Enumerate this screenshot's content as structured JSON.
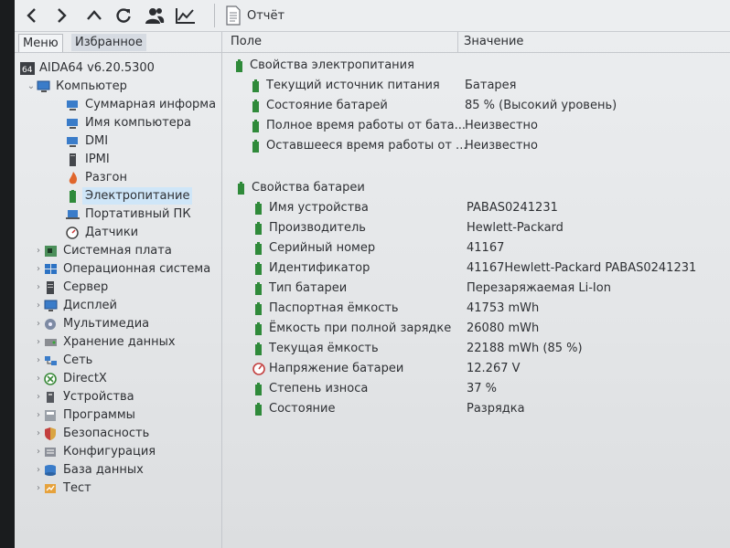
{
  "toolbar": {
    "report_label": "Отчёт"
  },
  "tabs": {
    "menu": "Меню",
    "favorites": "Избранное"
  },
  "tree": {
    "root": "AIDA64 v6.20.5300",
    "computer": "Компьютер",
    "computer_children": {
      "summary": "Суммарная информа",
      "computer_name": "Имя компьютера",
      "dmi": "DMI",
      "ipmi": "IPMI",
      "overclock": "Разгон",
      "power": "Электропитание",
      "portable": "Портативный ПК",
      "sensors": "Датчики"
    },
    "sections": {
      "motherboard": "Системная плата",
      "os": "Операционная система",
      "server": "Сервер",
      "display": "Дисплей",
      "multimedia": "Мультимедиа",
      "storage": "Хранение данных",
      "network": "Сеть",
      "directx": "DirectX",
      "devices": "Устройства",
      "software": "Программы",
      "security": "Безопасность",
      "config": "Конфигурация",
      "database": "База данных",
      "test": "Тест"
    }
  },
  "columns": {
    "field": "Поле",
    "value": "Значение"
  },
  "power_group": {
    "title": "Свойства электропитания",
    "rows": [
      {
        "field": "Текущий источник питания",
        "value": "Батарея"
      },
      {
        "field": "Состояние батарей",
        "value": "85 % (Высокий уровень)"
      },
      {
        "field": "Полное время работы от бата...",
        "value": "Неизвестно"
      },
      {
        "field": "Оставшееся время работы от ...",
        "value": "Неизвестно"
      }
    ]
  },
  "battery_group": {
    "title": "Свойства батареи",
    "rows": [
      {
        "field": "Имя устройства",
        "value": "PABAS0241231"
      },
      {
        "field": "Производитель",
        "value": "Hewlett-Packard"
      },
      {
        "field": "Серийный номер",
        "value": "41167"
      },
      {
        "field": "Идентификатор",
        "value": "41167Hewlett-Packard PABAS0241231"
      },
      {
        "field": "Тип батареи",
        "value": "Перезаряжаемая Li-Ion"
      },
      {
        "field": "Паспортная ёмкость",
        "value": "41753 mWh"
      },
      {
        "field": "Ёмкость при полной зарядке",
        "value": "26080 mWh"
      },
      {
        "field": "Текущая ёмкость",
        "value": "22188 mWh  (85 %)"
      },
      {
        "field": "Напряжение батареи",
        "value": "12.267 V"
      },
      {
        "field": "Степень износа",
        "value": "37 %"
      },
      {
        "field": "Состояние",
        "value": "Разрядка"
      }
    ]
  },
  "colors": {
    "selection": "#cfe6f8",
    "battery_icon": "#2f8a3a",
    "accent_blue": "#2d73c4"
  }
}
